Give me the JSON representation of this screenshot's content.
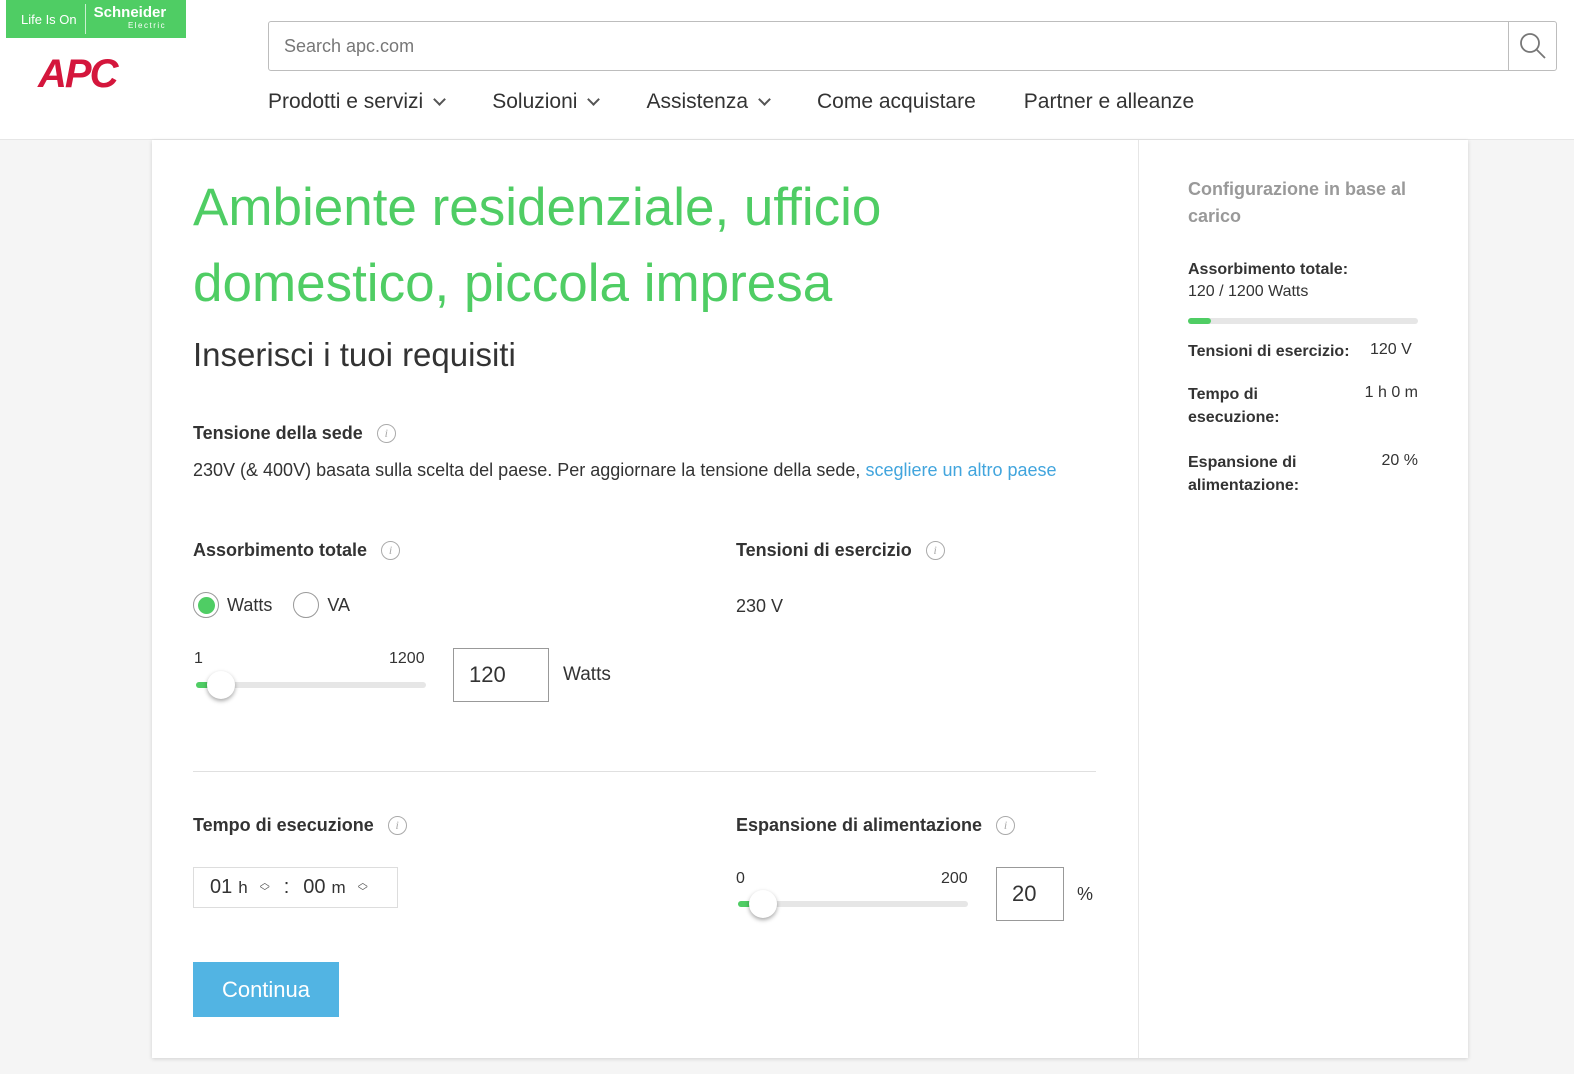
{
  "header": {
    "brand_tagline": "Life Is On",
    "brand_name": "Schneider",
    "brand_sub": "Electric",
    "logo": "APC",
    "search_placeholder": "Search apc.com",
    "nav": [
      {
        "label": "Prodotti e servizi",
        "dropdown": true
      },
      {
        "label": "Soluzioni",
        "dropdown": true
      },
      {
        "label": "Assistenza",
        "dropdown": true
      },
      {
        "label": "Come acquistare",
        "dropdown": false
      },
      {
        "label": "Partner e alleanze",
        "dropdown": false
      }
    ]
  },
  "main": {
    "title": "Ambiente residenziale, ufficio domestico, piccola impresa",
    "subtitle": "Inserisci i tuoi requisiti",
    "site_voltage": {
      "label": "Tensione della sede",
      "text": "230V (& 400V) basata sulla scelta del paese. Per aggiornare la tensione della sede, ",
      "link": "scegliere un altro paese"
    },
    "load": {
      "label": "Assorbimento totale",
      "options": [
        "Watts",
        "VA"
      ],
      "selected": "Watts",
      "min": "1",
      "max": "1200",
      "value": "120",
      "unit": "Watts",
      "fraction": 0.1
    },
    "operating_voltage": {
      "label": "Tensioni di esercizio",
      "value": "230 V"
    },
    "runtime": {
      "label": "Tempo di esecuzione",
      "hours": "01",
      "h_unit": "h",
      "sep": ":",
      "minutes": "00",
      "m_unit": "m"
    },
    "expansion": {
      "label": "Espansione di alimentazione",
      "min": "0",
      "max": "200",
      "value": "20",
      "unit": "%",
      "fraction": 0.1
    },
    "continue": "Continua"
  },
  "sidebar": {
    "title": "Configurazione in base al carico",
    "load_label": "Assorbimento totale:",
    "load_value": "120 / 1200 Watts",
    "load_fraction": 0.1,
    "voltage_label": "Tensioni di esercizio:",
    "voltage_value": "120 V",
    "runtime_label": "Tempo di esecuzione:",
    "runtime_value": "1 h 0 m",
    "expansion_label": "Espansione di alimentazione:",
    "expansion_value": "20 %"
  },
  "colors": {
    "accent": "#4fcd64",
    "link": "#42a5dd",
    "button": "#52b4e3",
    "brand_red": "#d4163c"
  }
}
